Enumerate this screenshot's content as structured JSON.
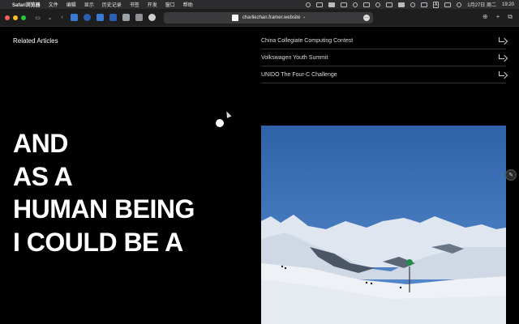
{
  "menubar": {
    "app": "Safari浏览器",
    "items": [
      "文件",
      "编辑",
      "显示",
      "历史记录",
      "书签",
      "开发",
      "窗口",
      "帮助"
    ],
    "date": "1月27日 周二",
    "time": "19:20",
    "input_badge": "A"
  },
  "toolbar": {
    "url": "charliezhan.framer.website",
    "extension_colors": [
      "#3a7bd5",
      "#2b5fb4",
      "#9aa0a6",
      "#8e8e93",
      "#cfcfcf"
    ]
  },
  "page": {
    "related_title": "Related Articles",
    "articles": [
      "China Collegiate Computing Contest",
      "Volkswagen Youth Summit",
      "UNIDO The Four-C Challenge"
    ],
    "headline": [
      "AND",
      "AS A",
      "HUMAN BEING",
      "I COULD BE A"
    ]
  },
  "colors": {
    "background": "#000000",
    "text": "#ffffff",
    "sky": "#3d6fb0",
    "snow": "#eef2f7"
  }
}
